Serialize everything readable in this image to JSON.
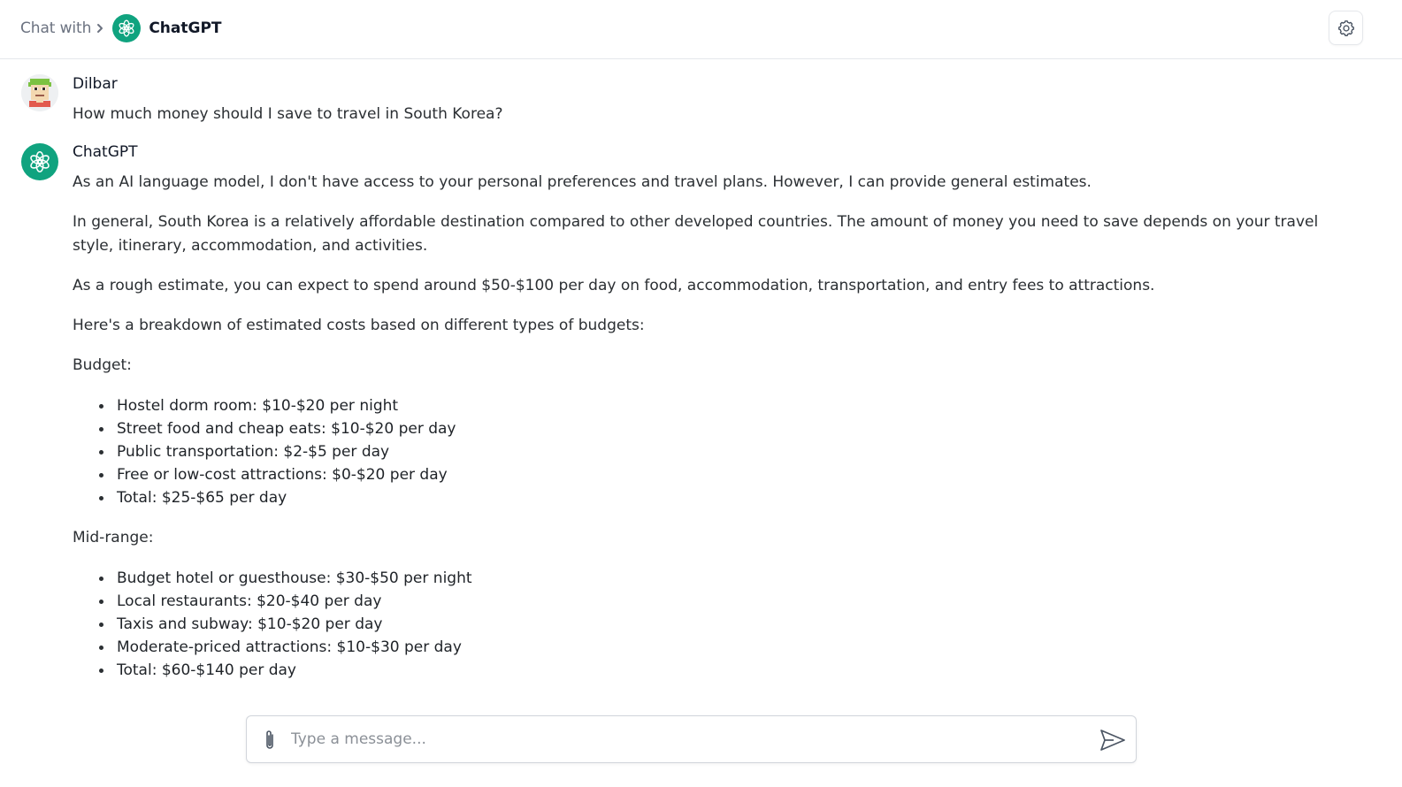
{
  "header": {
    "breadcrumb_label": "Chat with",
    "bot_name": "ChatGPT"
  },
  "icons": {
    "chevron": "chevron-right-icon",
    "bot_logo": "openai-logo-icon",
    "settings": "gear-icon",
    "attach": "paperclip-icon",
    "send": "send-icon"
  },
  "colors": {
    "accent": "#10a37f",
    "border": "#e5e7eb"
  },
  "messages": [
    {
      "sender": "Dilbar",
      "text": "How much money should I save to travel in South Korea?"
    },
    {
      "sender": "ChatGPT",
      "paragraphs": [
        "As an AI language model, I don't have access to your personal preferences and travel plans. However, I can provide general estimates.",
        "In general, South Korea is a relatively affordable destination compared to other developed countries. The amount of money you need to save depends on your travel style, itinerary, accommodation, and activities.",
        "As a rough estimate, you can expect to spend around $50-$100 per day on food, accommodation, transportation, and entry fees to attractions.",
        "Here's a breakdown of estimated costs based on different types of budgets:"
      ],
      "sections": [
        {
          "heading": "Budget:",
          "items": [
            "Hostel dorm room: $10-$20 per night",
            "Street food and cheap eats: $10-$20 per day",
            "Public transportation: $2-$5 per day",
            "Free or low-cost attractions: $0-$20 per day",
            "Total: $25-$65 per day"
          ]
        },
        {
          "heading": "Mid-range:",
          "items": [
            "Budget hotel or guesthouse: $30-$50 per night",
            "Local restaurants: $20-$40 per day",
            "Taxis and subway: $10-$20 per day",
            "Moderate-priced attractions: $10-$30 per day",
            "Total: $60-$140 per day"
          ]
        }
      ]
    }
  ],
  "composer": {
    "placeholder": "Type a message..."
  }
}
